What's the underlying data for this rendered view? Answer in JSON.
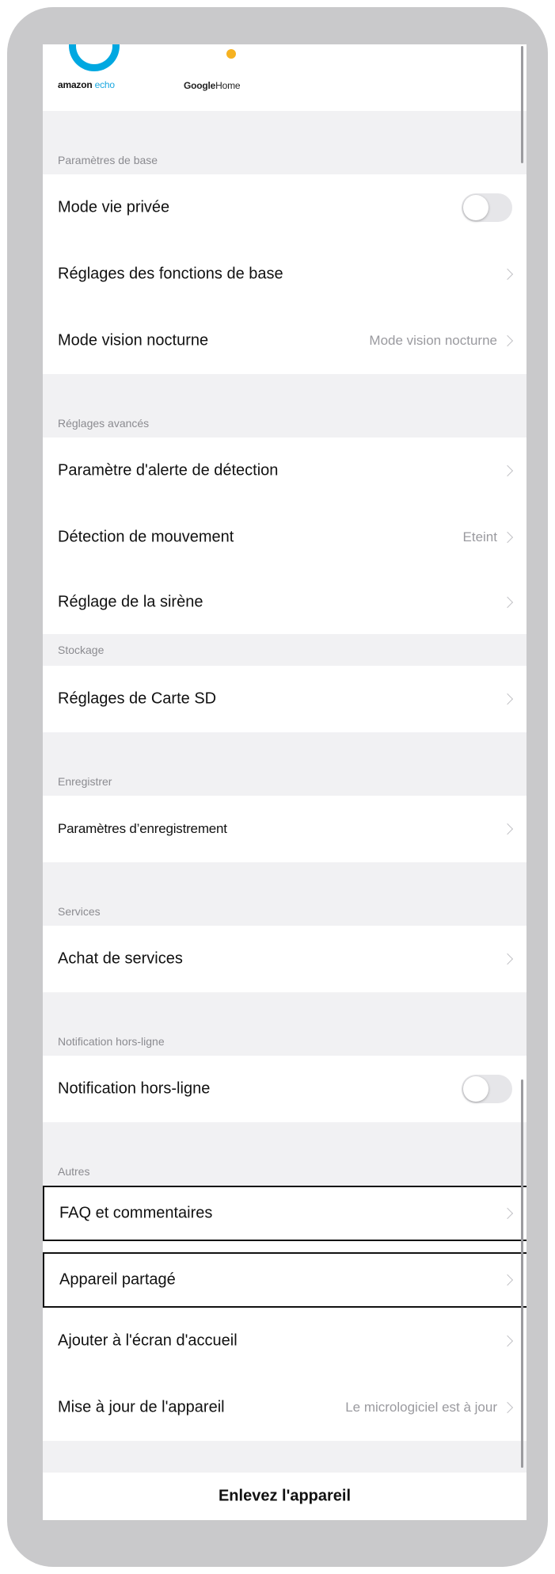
{
  "logos": {
    "amazon": "amazon",
    "echo": "echo",
    "google": "Google",
    "home": "Home"
  },
  "sections": {
    "basic": "Paramètres de base",
    "advanced": "Réglages avancés",
    "storage": "Stockage",
    "record": "Enregistrer",
    "services": "Services",
    "offline": "Notification hors-ligne",
    "others": "Autres"
  },
  "rows": {
    "privacy": {
      "label": "Mode vie privée",
      "on": false
    },
    "basic_functions": {
      "label": "Réglages des fonctions de base"
    },
    "night_vision": {
      "label": "Mode vision nocturne",
      "value": "Mode vision nocturne"
    },
    "detection_alert": {
      "label": "Paramètre d'alerte de détection"
    },
    "motion": {
      "label": "Détection de mouvement",
      "value": "Eteint"
    },
    "siren": {
      "label": "Réglage de la sirène"
    },
    "sd_card": {
      "label": "Réglages de Carte SD"
    },
    "recording": {
      "label": "Paramètres d’enregistrement"
    },
    "buy_services": {
      "label": "Achat de services"
    },
    "offline_notif": {
      "label": "Notification hors-ligne",
      "on": false
    },
    "faq": {
      "label": "FAQ et commentaires"
    },
    "shared": {
      "label": "Appareil partagé"
    },
    "home_screen": {
      "label": "Ajouter à l'écran d'accueil"
    },
    "update": {
      "label": "Mise à jour de l'appareil",
      "value": "Le micrologiciel est à jour"
    }
  },
  "remove_button": "Enlevez l'appareil",
  "colors": {
    "section_bg": "#f1f1f3",
    "row_bg": "#ffffff",
    "echo_blue": "#00a8e1",
    "google_yellow": "#f6b221",
    "frame": "#c9c9cb"
  }
}
